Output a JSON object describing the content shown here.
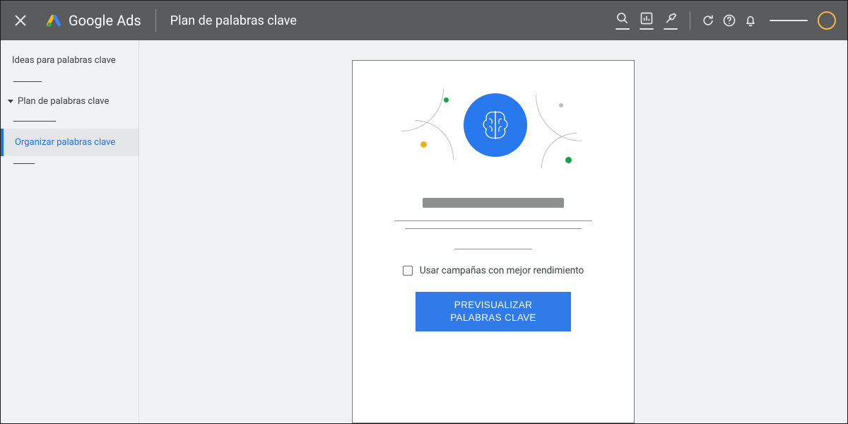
{
  "header": {
    "brand": "Google Ads",
    "page_title": "Plan de palabras clave"
  },
  "sidebar": {
    "item_ideas": "Ideas para palabras clave",
    "item_plan": "Plan de palabras clave",
    "item_organize": "Organizar palabras clave"
  },
  "card": {
    "checkbox_label": "Usar campañas con mejor rendimiento",
    "cta_label": "PREVISUALIZAR PALABRAS CLAVE"
  }
}
